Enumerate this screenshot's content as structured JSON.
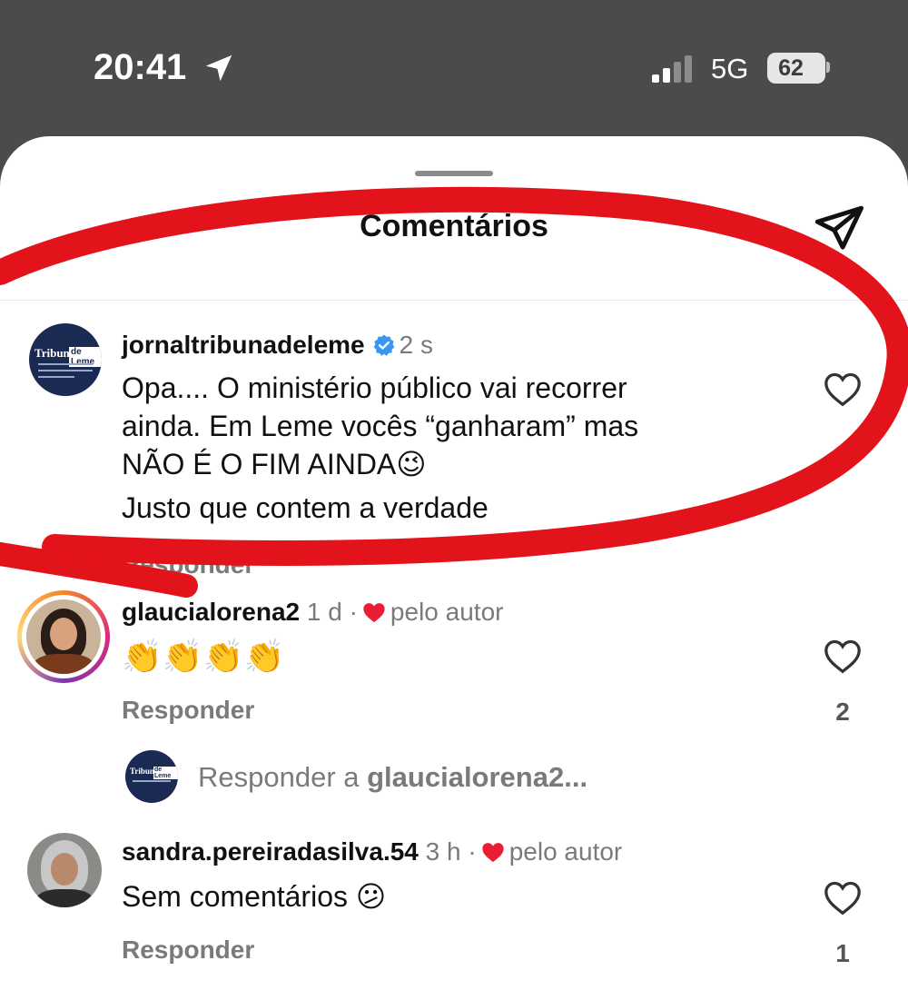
{
  "status_bar": {
    "time": "20:41",
    "network": "5G",
    "battery": "62"
  },
  "sheet": {
    "title": "Comentários"
  },
  "comments": [
    {
      "username": "jornaltribunadeleme",
      "verified": true,
      "time": "2 s",
      "lines": [
        "Opa.... O ministério público vai recorrer",
        "ainda. Em Leme vocês “ganharam” mas",
        "NÃO É O FIM AINDA😉",
        "Justo que contem a verdade"
      ],
      "reply_label": "Responder"
    },
    {
      "username": "glaucialorena2",
      "time": "1 d",
      "separator": "·",
      "liked_by_author": "pelo autor",
      "text": "👏👏👏👏",
      "reply_label": "Responder",
      "like_count": "2"
    },
    {
      "username": "sandra.pereiradasilva.54",
      "time": "3 h",
      "separator": "·",
      "liked_by_author": "pelo autor",
      "text": "Sem comentários 😕",
      "reply_label": "Responder",
      "like_count": "1"
    }
  ],
  "reply_field": {
    "prefix": "Responder a ",
    "target": "glaucialorena2..."
  },
  "avatar_logo": {
    "a": "Tribuna",
    "b": "de Leme"
  },
  "colors": {
    "accent_red": "#e3131b",
    "verified_blue": "#3897f0",
    "heart_red": "#ed1c35"
  },
  "icons": [
    "location-arrow-icon",
    "signal-icon",
    "share-icon",
    "verified-badge-icon",
    "heart-icon"
  ]
}
